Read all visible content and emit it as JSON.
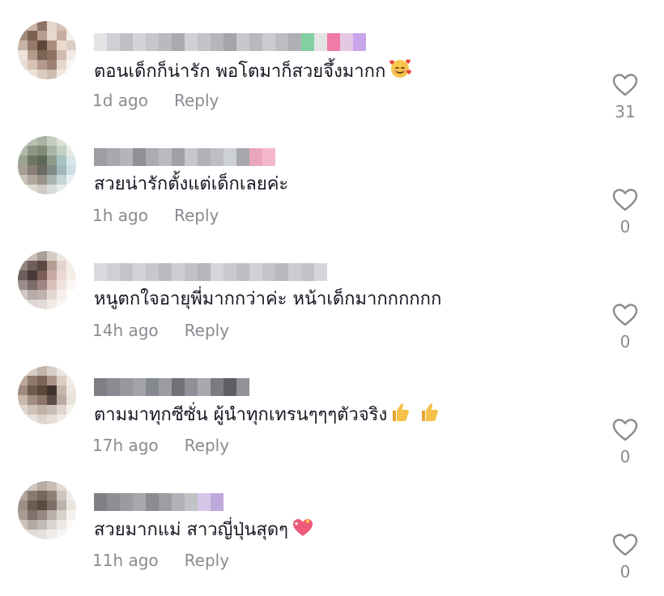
{
  "comments": [
    {
      "text": "ตอนเด็กก็น่ารัก พอโตมาก็สวยจึ้งมากก",
      "time": "1d ago",
      "reply_label": "Reply",
      "likes": "31",
      "emoji": "smiling-face-with-hearts",
      "avatar_colors": [
        "#b9a89a",
        "#c9b3a2",
        "#8f7565",
        "#e3d6cc",
        "#d2c1b4",
        "#f0e8e2",
        "#a38b7b",
        "#7c6152",
        "#b79e8e",
        "#e6d8cd",
        "#c6ad9d",
        "#f5efea",
        "#c8b4a6",
        "#96796a",
        "#5e4638",
        "#a98d7c",
        "#ead9cd",
        "#dccdc2",
        "#efe3d9",
        "#b59b8c",
        "#7d6353",
        "#8d7262",
        "#cfbcae",
        "#f2ebe5",
        "#e8ddd4",
        "#d5c3b6",
        "#b49b8d",
        "#9b8272",
        "#e5d9cf",
        "#faf6f2",
        "#f4efea",
        "#ece2da",
        "#d9cbc0",
        "#cdbdb0",
        "#f1eae4",
        "#ffffff"
      ],
      "username_colors": [
        "#e4e4e6",
        "#cfd0d3",
        "#bfc0c4",
        "#d3d4d7",
        "#c6c7ca",
        "#b9babd",
        "#a9aaae",
        "#d0d1d4",
        "#c2c3c6",
        "#b5b6ba",
        "#a4a5a9",
        "#c7c8cb",
        "#b8b9bc",
        "#cbccd0",
        "#bcbdc0",
        "#afb0b4",
        "#82cfa1",
        "#e4e4e6",
        "#f07aa8",
        "#e4c9e5",
        "#c9a6ec"
      ]
    },
    {
      "text": "สวยน่ารักตั้งแต่เด็กเลยค่ะ",
      "time": "1h ago",
      "reply_label": "Reply",
      "likes": "0",
      "emoji": "",
      "avatar_colors": [
        "#d4d9cf",
        "#b8bfb2",
        "#a9b2a2",
        "#c5cbbf",
        "#dde2d8",
        "#eff2ec",
        "#b3baa9",
        "#8d9685",
        "#7f8b78",
        "#a8b6a6",
        "#c4d0c3",
        "#e8ece5",
        "#9aa292",
        "#6e7766",
        "#5d6956",
        "#8c9b88",
        "#a8c2c4",
        "#d8e7ea",
        "#a59d93",
        "#8a7f76",
        "#6a6b62",
        "#7f8c86",
        "#9fb7bb",
        "#cfe0e4",
        "#c9c2b9",
        "#b2a79d",
        "#9a948b",
        "#a9b2ae",
        "#c6d4d6",
        "#eaf0f1",
        "#f0ede9",
        "#ddd8d2",
        "#cfcbc5",
        "#d8dcd9",
        "#e6ecec",
        "#ffffff"
      ],
      "username_colors": [
        "#9c9ea3",
        "#a7a9ae",
        "#b3b5ba",
        "#8f9196",
        "#aaacb1",
        "#b9bbc0",
        "#9fa1a6",
        "#c5c7cc",
        "#b0b2b7",
        "#bcbec3",
        "#cdd0d5",
        "#a6a8ad",
        "#e9a6be",
        "#f5b8cb"
      ]
    },
    {
      "text": "หนูตกใจอายุพี่มากกว่าค่ะ หน้าเด็กมากกกกกก",
      "time": "14h ago",
      "reply_label": "Reply",
      "likes": "0",
      "emoji": "",
      "avatar_colors": [
        "#e3dedb",
        "#c9c0bb",
        "#a99e98",
        "#d7cbc5",
        "#ece6e2",
        "#f8f5f3",
        "#8f8580",
        "#6e5f5a",
        "#5c4843",
        "#b59c93",
        "#e2d3cd",
        "#f3ece9",
        "#6b5e5c",
        "#4a3a37",
        "#7a5d57",
        "#c9aaa2",
        "#ead8d2",
        "#f6ede9",
        "#9a8e8c",
        "#7d6d6a",
        "#a08682",
        "#d8c1ba",
        "#f0e4df",
        "#fbf6f3",
        "#cfc8c5",
        "#b6aba8",
        "#c2b2ae",
        "#e4d8d3",
        "#f5eeea",
        "#ffffff",
        "#eeebe9",
        "#ddd6d3",
        "#e2dad6",
        "#f0eae6",
        "#faf6f4",
        "#ffffff"
      ],
      "username_colors": [
        "#d9dadd",
        "#cfd0d3",
        "#c3c4c7",
        "#d2d3d6",
        "#c7c8cb",
        "#bbbcbf",
        "#cdced1",
        "#c0c1c4",
        "#b5b6b9",
        "#d4d5d8",
        "#c8c9cc",
        "#bdbec1",
        "#d0d1d4",
        "#c4c5c8",
        "#b9babd",
        "#cbccd0",
        "#c2c3c6",
        "#d6d7da"
      ]
    },
    {
      "text": "ตามมาทุกซีซั่น ผู้นำทุกเทรนๆๆๆตัวจริง",
      "time": "17h ago",
      "reply_label": "Reply",
      "likes": "0",
      "emoji": "thumbs-up",
      "avatar_colors": [
        "#e7e1dc",
        "#d5cbc3",
        "#c2b5aa",
        "#d9cfc7",
        "#ece6e1",
        "#f8f5f2",
        "#b9a89b",
        "#8f7a6c",
        "#7b6557",
        "#a99486",
        "#d9cdc4",
        "#f1ebe6",
        "#9e8a7d",
        "#6f5b4e",
        "#5b4639",
        "#3f342e",
        "#c5b6ab",
        "#eee7e1",
        "#c7b8ad",
        "#a18d80",
        "#8a7568",
        "#5a4d45",
        "#b8aaa0",
        "#e9e2dc",
        "#e0d6ce",
        "#cfc2b8",
        "#bfb1a6",
        "#c9bdb4",
        "#dfd6cf",
        "#f5f1ed",
        "#f3efeb",
        "#e8e1db",
        "#ddd4cd",
        "#e5ddd7",
        "#f0ebe6",
        "#ffffff"
      ],
      "username_colors": [
        "#7d7f85",
        "#8a8c92",
        "#96989e",
        "#a2a4aa",
        "#868890",
        "#9a9ca2",
        "#6f7177",
        "#8e9096",
        "#a7a9af",
        "#7a7c82",
        "#5c5e64",
        "#909298"
      ]
    },
    {
      "text": "สวยมากแม่ สาวญี่ปุ่นสุดๆ",
      "time": "11h ago",
      "reply_label": "Reply",
      "likes": "0",
      "emoji": "sparkling-heart",
      "avatar_colors": [
        "#e5e0dc",
        "#cfc6bf",
        "#b7aba2",
        "#c8bdb5",
        "#e2dbd6",
        "#f6f3f0",
        "#b1a49a",
        "#8a7a6e",
        "#76665b",
        "#8d7f75",
        "#cfc5be",
        "#f0ebe7",
        "#9d8f85",
        "#6c5c51",
        "#5a4a40",
        "#7d6f66",
        "#bdb2aa",
        "#ebe5e0",
        "#a89b92",
        "#80716a",
        "#94877f",
        "#b9b0aa",
        "#d7d0cb",
        "#f4f0ed",
        "#cdc4be",
        "#b4aaa4",
        "#c2bab5",
        "#dbd5d1",
        "#ece8e5",
        "#fbf9f7",
        "#efebe8",
        "#e0dbd7",
        "#e4e0dd",
        "#efecea",
        "#f7f5f3",
        "#ffffff"
      ],
      "username_colors": [
        "#7f8187",
        "#8d8f95",
        "#999ba1",
        "#a6a8ae",
        "#8a8c92",
        "#9c9ea4",
        "#b0b2b8",
        "#c0c2c8",
        "#d6c6e8",
        "#bfa8dc"
      ]
    }
  ]
}
